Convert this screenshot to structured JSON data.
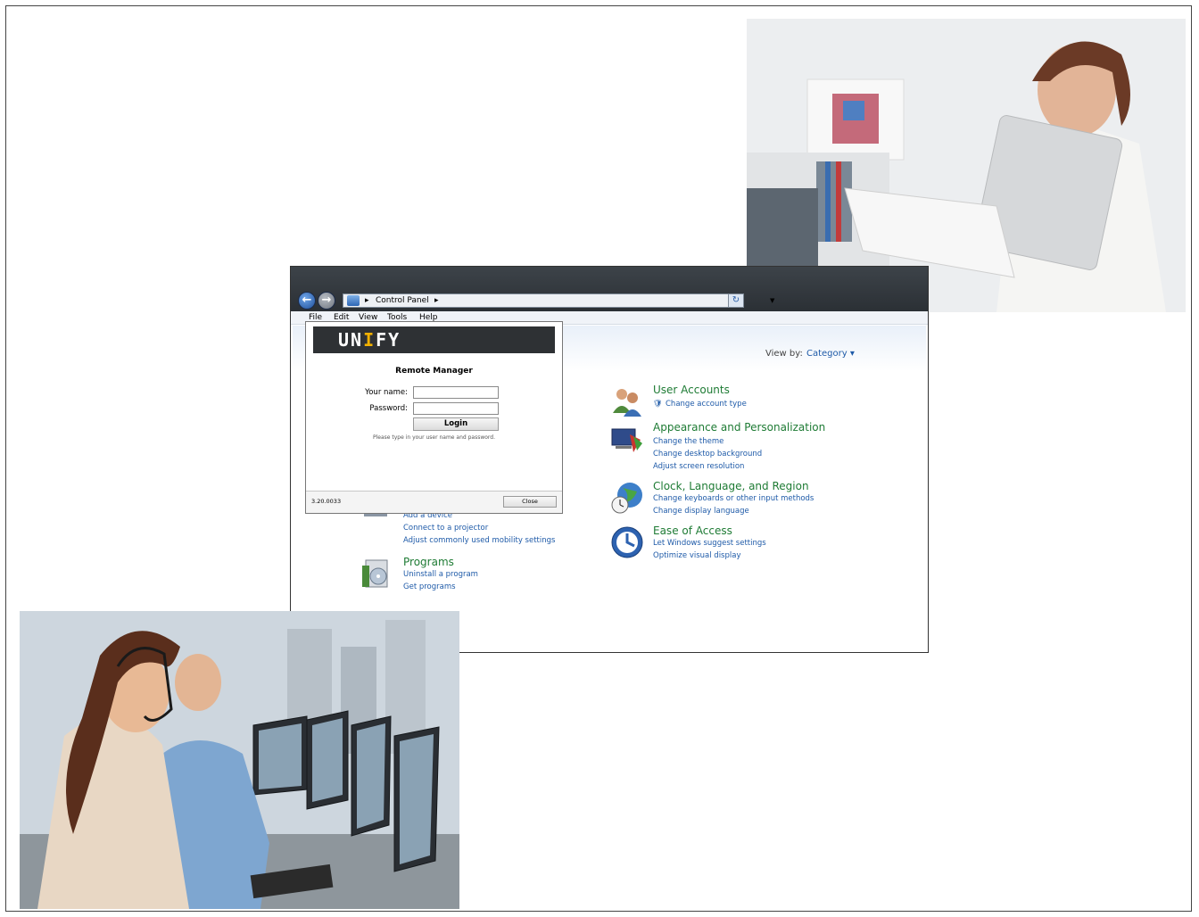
{
  "explorer": {
    "address_crumb": "Control Panel",
    "address_arrow": "▸",
    "menu": [
      "File",
      "Edit",
      "View",
      "Tools",
      "Help"
    ],
    "view_by_label": "View by:",
    "view_by_value": "Category ▾",
    "categories_right": [
      {
        "title": "User Accounts",
        "links": [
          "Change account type"
        ]
      },
      {
        "title": "Appearance and Personalization",
        "links": [
          "Change the theme",
          "Change desktop background",
          "Adjust screen resolution"
        ]
      },
      {
        "title": "Clock, Language, and Region",
        "links": [
          "Change keyboards or other input methods",
          "Change display language"
        ]
      },
      {
        "title": "Ease of Access",
        "links": [
          "Let Windows suggest settings",
          "Optimize visual display"
        ]
      }
    ],
    "categories_left": [
      {
        "title": "",
        "links": [
          "Add a device",
          "Connect to a projector",
          "Adjust commonly used mobility settings"
        ]
      },
      {
        "title": "Programs",
        "links": [
          "Uninstall a program",
          "Get programs"
        ]
      }
    ]
  },
  "remote_manager": {
    "logo_left": "UN",
    "logo_accent": "I",
    "logo_right": "FY",
    "title": "Remote Manager",
    "username_label": "Your name:",
    "password_label": "Password:",
    "login_label": "Login",
    "hint": "Please type in your user name and password.",
    "version": "3.20.0033",
    "close_label": "Close"
  }
}
